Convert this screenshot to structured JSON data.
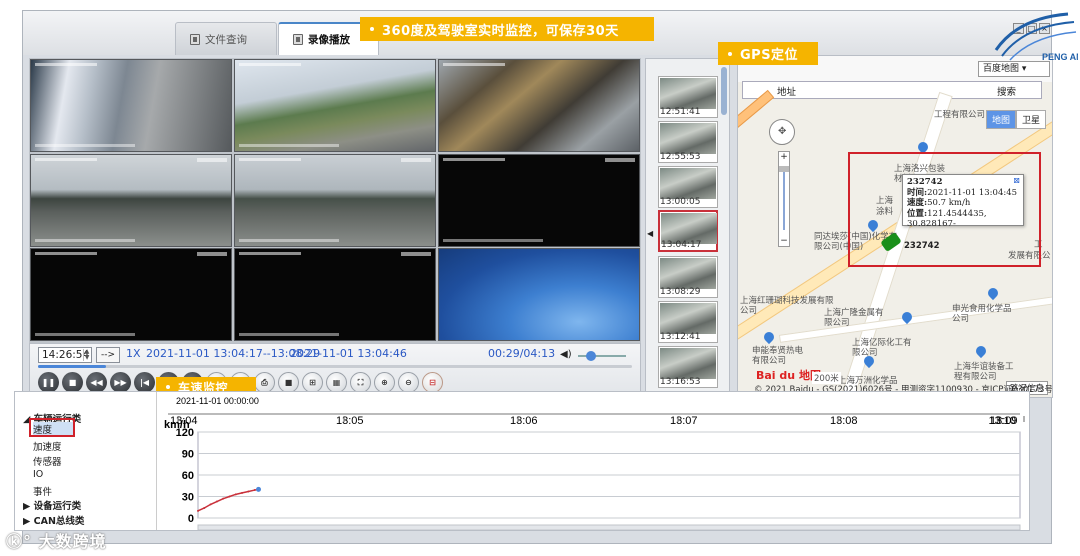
{
  "tabs": [
    {
      "label": "文件查询"
    },
    {
      "label": "录像播放"
    }
  ],
  "banners": {
    "top": "360度及驾驶室实时监控，可保存30天",
    "gps": "GPS定位",
    "speed": "车速监控"
  },
  "player": {
    "time": "14:26:54",
    "arrow": "-->",
    "speed": "1X",
    "range": "2021-11-01 13:04:17--13:08:29",
    "current": "2021-11-01 13:04:46",
    "progress": "00:29/04:13",
    "progress_frac": 0.115
  },
  "buttons": [
    "pause",
    "stop",
    "rewind",
    "forward",
    "prev",
    "next",
    "snapshot",
    "AVI",
    "GPS",
    "print",
    "window1",
    "window4",
    "window9",
    "fullscreen",
    "zoom-in",
    "zoom-out",
    "close"
  ],
  "thumbnails": [
    {
      "time": "12:51:41"
    },
    {
      "time": "12:55:53"
    },
    {
      "time": "13:00:05"
    },
    {
      "time": "13:04:17",
      "selected": true
    },
    {
      "time": "13:08:29"
    },
    {
      "time": "13:12:41"
    },
    {
      "time": "13:16:53"
    }
  ],
  "map": {
    "provider": "百度地图",
    "address_label": "地址",
    "search_label": "搜索",
    "mode_map": "地图",
    "mode_sat": "卫星",
    "scale": "200米",
    "traffic": "路况信息",
    "copyright": "© 2021 Baidu - GS(2021)6026号 - 甲测资字1100930 - 京ICP证030173号 - Da",
    "baidu_logo": "Bai du 地图",
    "pois": [
      "工程有限公司",
      "上海洛兴包装材料有限公司",
      "上海",
      "涂料",
      "同达埃莎(中国)化学有限公司(中国)",
      "工",
      "发展有限公",
      "上海红珊瑚科技发展有限公司",
      "上海广隆金属有限公司",
      "申光食用化学品公司",
      "申能奉贤热电有限公司",
      "上海亿际化工有限公司",
      "上海万洲化学品",
      "上海华谊装备工程有限公司"
    ],
    "popup": {
      "id": "232742",
      "time_label": "时间:",
      "time": "2021-11-01 13:04:45",
      "speed_label": "速度:",
      "speed": "50.7 km/h",
      "pos_label": "位置:",
      "pos": "121.4544435, 30.828167-"
    },
    "car_label": "232742"
  },
  "tree": {
    "items": [
      {
        "label": "车辆运行类",
        "group": true
      },
      {
        "label": "速度",
        "selected": true
      },
      {
        "label": "加速度"
      },
      {
        "label": "传感器"
      },
      {
        "label": "IO"
      },
      {
        "label": "事件"
      },
      {
        "label": "设备运行类",
        "group": true
      },
      {
        "label": "CAN总线类",
        "group": true
      }
    ]
  },
  "chart_data": {
    "type": "line",
    "x_start": "2021-11-01 00:00:00",
    "x_ticks": [
      "13:04",
      "13:05",
      "13:06",
      "13:07",
      "13:08",
      "13:09",
      "13:10"
    ],
    "ylabel": "km/h",
    "y_ticks": [
      120,
      90,
      60,
      30,
      0
    ],
    "ylim": [
      0,
      120
    ],
    "series": [
      {
        "values": [
          [
            0,
            10
          ],
          [
            0.05,
            14
          ],
          [
            0.1,
            19
          ],
          [
            0.15,
            23
          ],
          [
            0.2,
            27
          ],
          [
            0.25,
            30
          ],
          [
            0.3,
            33
          ],
          [
            0.35,
            35
          ],
          [
            0.4,
            37
          ],
          [
            0.45,
            39
          ],
          [
            0.48,
            40
          ]
        ]
      }
    ]
  },
  "brand": {
    "logo": "PENG AN"
  },
  "watermark": "大数跨境",
  "colors": {
    "accent": "#f5b400",
    "highlight": "#d0212a",
    "line": "#c9303a",
    "blue": "#4b86d8"
  }
}
